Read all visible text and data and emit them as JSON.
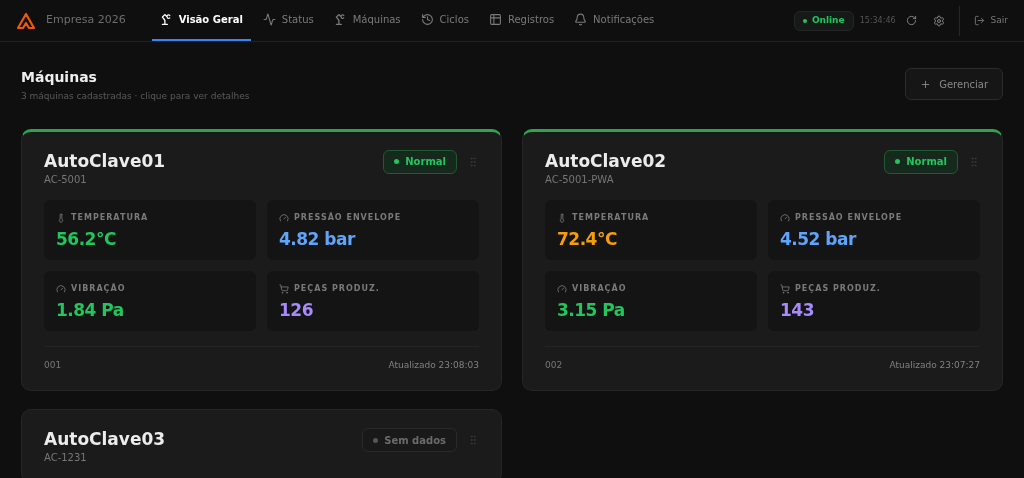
{
  "brand": {
    "name": "Empresa 2026"
  },
  "nav": [
    {
      "label": "Visão Geral",
      "selected": true
    },
    {
      "label": "Status",
      "selected": false
    },
    {
      "label": "Máquinas",
      "selected": false
    },
    {
      "label": "Ciclos",
      "selected": false
    },
    {
      "label": "Registros",
      "selected": false
    },
    {
      "label": "Notificações",
      "selected": false
    }
  ],
  "connection": {
    "label": "Online",
    "online": true
  },
  "clock": "15:34:46",
  "logout": "Sair",
  "page": {
    "title": "Máquinas",
    "subtitle": "3 máquinas cadastradas · clique para ver detalhes",
    "action": "Gerenciar"
  },
  "machines": [
    {
      "name": "AutoClave01",
      "code": "AC-5001",
      "status": {
        "kind": "normal",
        "label": "Normal"
      },
      "metrics": [
        {
          "kind": "temperature",
          "label": "TEMPERATURA",
          "value": "56.2°C",
          "color": "#22c55e"
        },
        {
          "kind": "pressure",
          "label": "PRESSÃO ENVELOPE",
          "value": "4.82 bar",
          "color": "#60a5fa"
        },
        {
          "kind": "vibration",
          "label": "VIBRAÇÃO",
          "value": "1.84 Pa",
          "color": "#22c55e"
        },
        {
          "kind": "parts",
          "label": "PEÇAS PRODUZ.",
          "value": "126",
          "color": "#a78bfa"
        }
      ],
      "id_label": "001",
      "updated": "Atualizado 23:08:03"
    },
    {
      "name": "AutoClave02",
      "code": "AC-5001-PWA",
      "status": {
        "kind": "normal",
        "label": "Normal"
      },
      "metrics": [
        {
          "kind": "temperature",
          "label": "TEMPERATURA",
          "value": "72.4°C",
          "color": "#f59e0b"
        },
        {
          "kind": "pressure",
          "label": "PRESSÃO ENVELOPE",
          "value": "4.52 bar",
          "color": "#60a5fa"
        },
        {
          "kind": "vibration",
          "label": "VIBRAÇÃO",
          "value": "3.15 Pa",
          "color": "#22c55e"
        },
        {
          "kind": "parts",
          "label": "PEÇAS PRODUZ.",
          "value": "143",
          "color": "#a78bfa"
        }
      ],
      "id_label": "002",
      "updated": "Atualizado 23:07:27"
    },
    {
      "name": "AutoClave03",
      "code": "AC-1231",
      "status": {
        "kind": "no_data",
        "label": "Sem dados"
      }
    }
  ]
}
